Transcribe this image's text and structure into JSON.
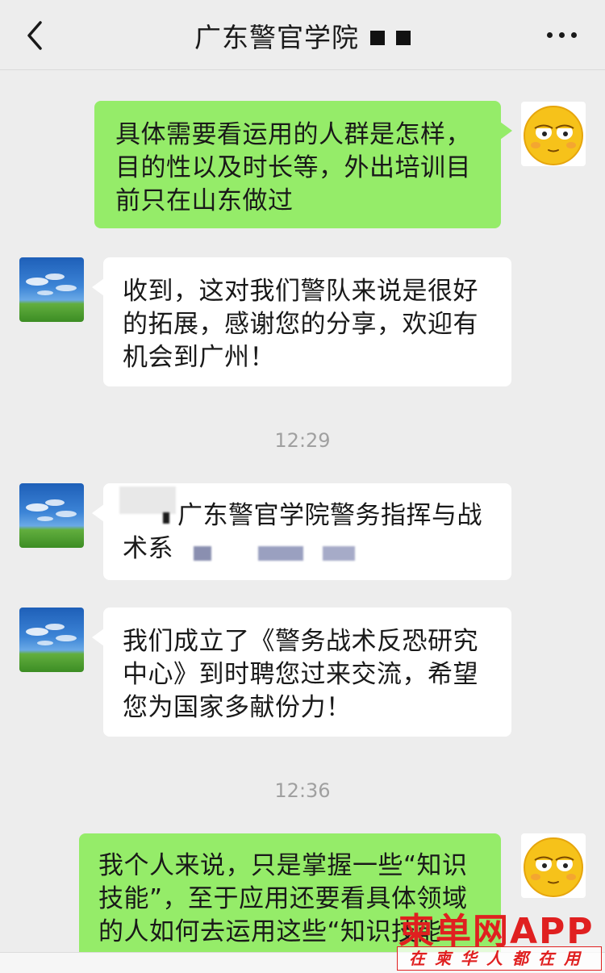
{
  "header": {
    "title": "广东警官学院"
  },
  "messages": [
    {
      "side": "right",
      "lines": [
        "具体需要看运用的人群是怎样，",
        "目的性以及时长等，外出培训目",
        "前只在山东做过"
      ]
    },
    {
      "side": "left",
      "lines": [
        "收到，这对我们警队来说是很好",
        "的拓展，感谢您的分享，欢迎有",
        "机会到广州！"
      ]
    },
    {
      "side": "left",
      "lines": [
        "广东警官学院警务指挥与战",
        "术系"
      ]
    },
    {
      "side": "left",
      "lines": [
        "我们成立了《警务战术反恐研究",
        "中心》到时聘您过来交流，希望",
        "您为国家多献份力！"
      ]
    },
    {
      "side": "right",
      "lines": [
        "我个人来说，只是掌握一些“知识",
        "技能”，至于应用还要看具体领域",
        "的人如何去运用这些“知识技能"
      ]
    }
  ],
  "timestamps": [
    "12:29",
    "12:36"
  ],
  "watermark": {
    "brand": "柬单网APP",
    "slogan": "在柬华人都在用"
  },
  "colors": {
    "background": "#ededed",
    "sent_bubble": "#95ec69",
    "received_bubble": "#ffffff",
    "watermark": "#e02020"
  }
}
